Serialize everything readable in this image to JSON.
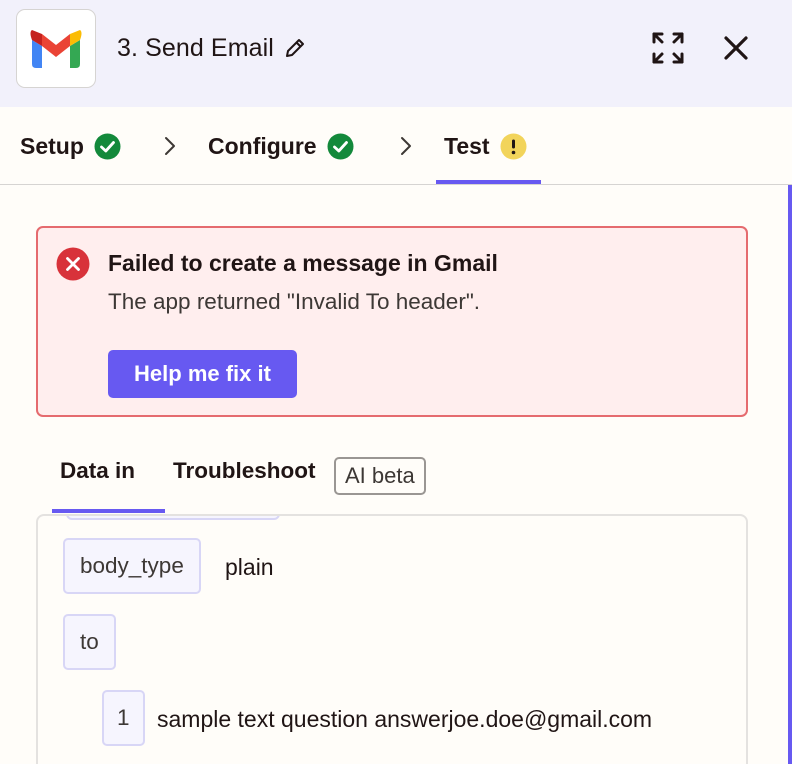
{
  "header": {
    "app_icon": "gmail-logo",
    "step_title": "3. Send Email",
    "edit_icon": "pencil-icon",
    "expand_icon": "expand-icon",
    "close_icon": "close-icon"
  },
  "stepper": {
    "steps": [
      {
        "label": "Setup",
        "status": "complete",
        "icon": "check-circle-icon"
      },
      {
        "label": "Configure",
        "status": "complete",
        "icon": "check-circle-icon"
      },
      {
        "label": "Test",
        "status": "warning",
        "icon": "warning-circle-icon",
        "active": true
      }
    ]
  },
  "alert": {
    "title": "Failed to create a message in Gmail",
    "message": "The app returned \"Invalid To header\".",
    "button_label": "Help me fix it",
    "icon": "error-circle-icon"
  },
  "subtabs": {
    "items": [
      {
        "label": "Data in",
        "active": true
      },
      {
        "label": "Troubleshoot",
        "active": false
      }
    ],
    "badge": "AI beta"
  },
  "data_in": {
    "rows": [
      {
        "key": "body_type",
        "value": "plain"
      },
      {
        "key": "to",
        "value": ""
      }
    ],
    "to_items": [
      {
        "index": "1",
        "value": "sample text question answerjoe.doe@gmail.com"
      }
    ]
  },
  "colors": {
    "accent": "#6759f1",
    "success": "#13893b",
    "warning": "#f2d45b",
    "error": "#d8323a",
    "alert_bg": "#ffeeee",
    "header_bg": "#f2f1fb"
  }
}
